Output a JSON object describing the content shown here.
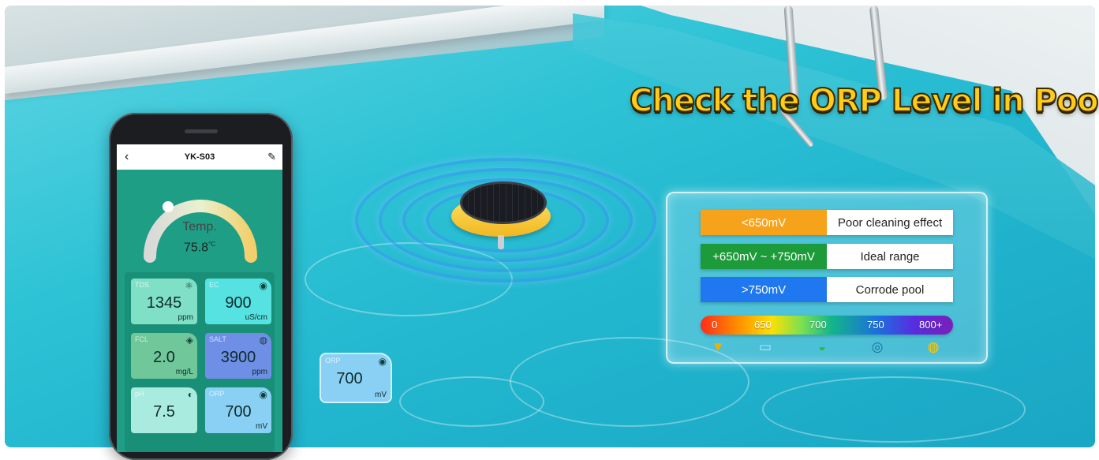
{
  "headline": "Check the ORP Level in Pool",
  "orp_panel": {
    "rows": [
      {
        "tag": "<650mV",
        "desc": "Poor cleaning effect",
        "color": "#f7a21b"
      },
      {
        "tag": "+650mV ~ +750mV",
        "desc": "Ideal range",
        "color": "#1d9a3a"
      },
      {
        "tag": ">750mV",
        "desc": "Corrode pool",
        "color": "#1f78f0"
      }
    ],
    "scale_labels": [
      "0",
      "650",
      "700",
      "750",
      "800+"
    ],
    "scale_icons": [
      "bucket-icon",
      "glass-icon",
      "bath-icon",
      "lifebuoy-icon",
      "swim-ring-icon"
    ]
  },
  "phone": {
    "device_name": "YK-S03",
    "gauge_label": "Temp.",
    "gauge_value": "75.8",
    "gauge_unit": "°C",
    "tiles": [
      {
        "label": "TDS",
        "value": "1345",
        "unit": "ppm",
        "color": "#7fe0c6",
        "icon": "⚛"
      },
      {
        "label": "EC",
        "value": "900",
        "unit": "uS/cm",
        "color": "#55e2e0",
        "icon": "◉"
      },
      {
        "label": "FCL",
        "value": "2.0",
        "unit": "mg/L",
        "color": "#6fc79a",
        "icon": "◈"
      },
      {
        "label": "SALT",
        "value": "3900",
        "unit": "ppm",
        "color": "#6f8fe6",
        "icon": "◍"
      },
      {
        "label": "pH",
        "value": "7.5",
        "unit": "",
        "color": "#a9ecdf",
        "icon": "◐"
      },
      {
        "label": "ORP",
        "value": "700",
        "unit": "mV",
        "color": "#8ad0f5",
        "icon": "◉"
      }
    ]
  },
  "orp_chip": {
    "label": "ORP",
    "value": "700",
    "unit": "mV"
  }
}
